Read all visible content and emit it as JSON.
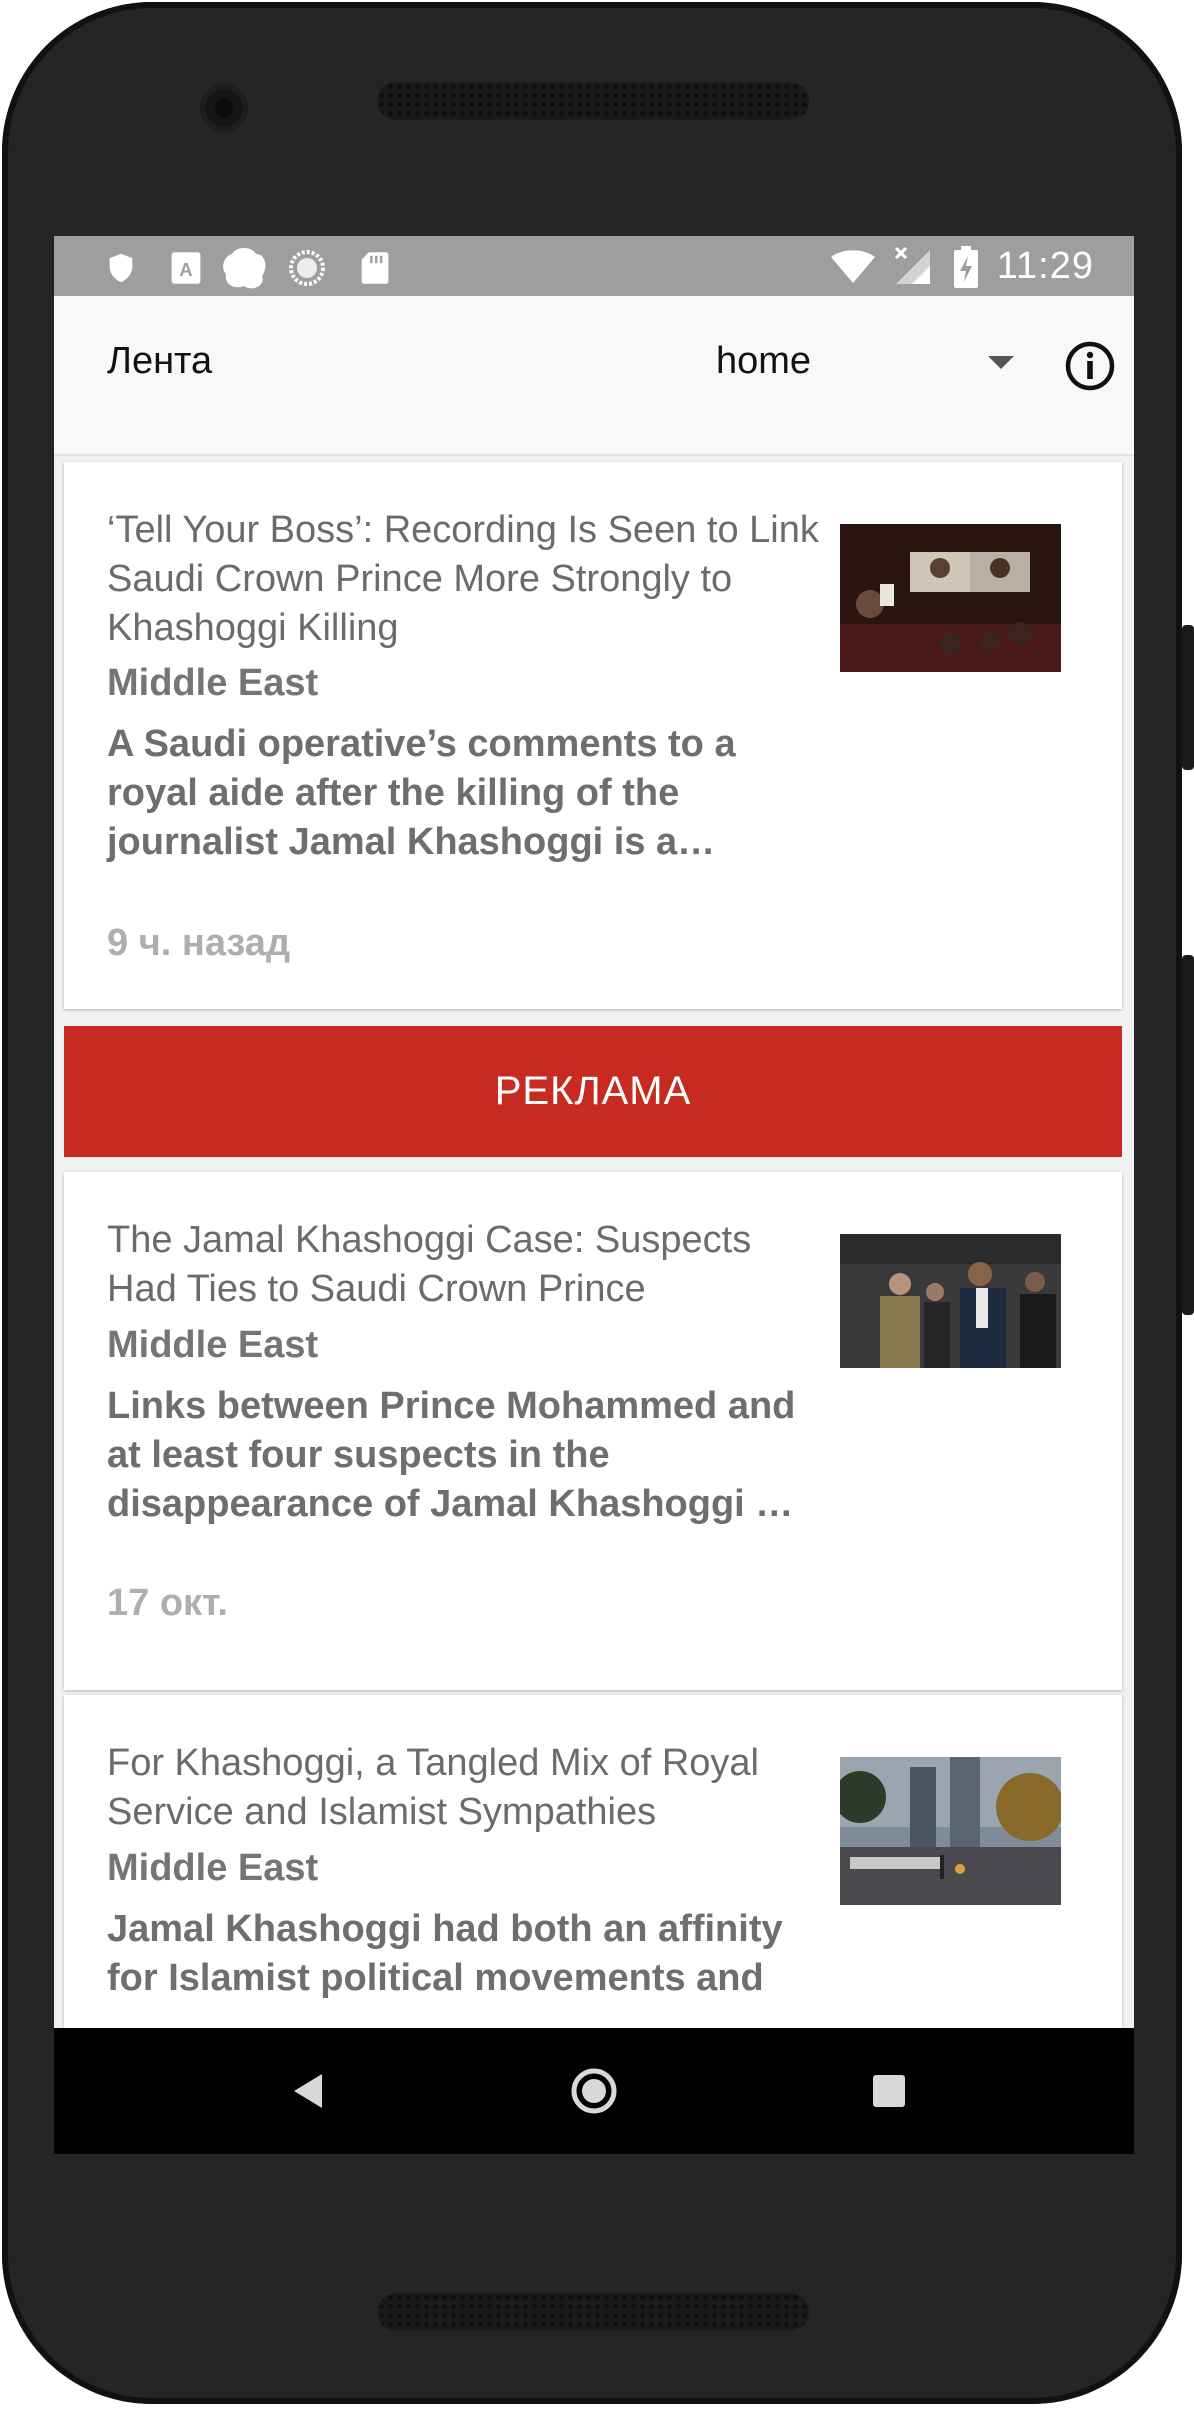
{
  "status_bar": {
    "time": "11:29",
    "left_icons": [
      "shield-icon",
      "font-a-icon",
      "cloud-icon",
      "sync-icon",
      "sd-card-icon"
    ],
    "right_icons": [
      "wifi-icon",
      "cell-signal-off-icon",
      "battery-charging-icon"
    ]
  },
  "app_bar": {
    "title": "Лента",
    "dropdown_value": "home",
    "info_icon": "info-icon"
  },
  "articles": [
    {
      "headline": "‘Tell Your Boss’: Recording Is Seen to Link Saudi Crown Prince More Strongly to Khashoggi Killing",
      "section": "Middle East",
      "summary": "A Saudi operative’s comments to a royal aide after the killing of the journalist Jamal Khashoggi is a…",
      "time": "9 ч. назад"
    },
    {
      "headline": "The Jamal Khashoggi Case: Suspects Had Ties to Saudi Crown Prince",
      "section": "Middle East",
      "summary": "Links between Prince Mohammed and at least four suspects in the disappearance of Jamal Khashoggi …",
      "time": "17 окт."
    },
    {
      "headline": "For Khashoggi, a Tangled Mix of Royal Service and Islamist Sympathies",
      "section": "Middle East",
      "summary": "Jamal Khashoggi had both an affinity for Islamist political movements and",
      "time": ""
    }
  ],
  "ad_banner": {
    "label": "РЕКЛАМА",
    "color": "#c62a20"
  },
  "nav_bar": {
    "icons": [
      "back-icon",
      "home-icon",
      "recents-icon"
    ]
  }
}
